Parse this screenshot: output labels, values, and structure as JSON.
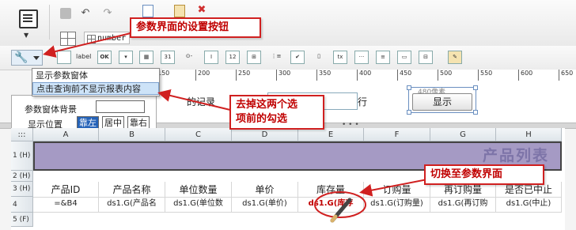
{
  "toolbar": {
    "number_control": "number"
  },
  "menu": {
    "items": [
      "显示参数窗体",
      "点击查询前不显示报表内容"
    ]
  },
  "settings_panel": {
    "bg_label": "参数窗体背景",
    "position_label": "显示位置",
    "position_options": [
      "靠左",
      "居中",
      "靠右"
    ],
    "selected_position": "靠左"
  },
  "ruler": {
    "ticks": [
      "150",
      "200",
      "250",
      "300",
      "350",
      "400",
      "450",
      "500",
      "550",
      "600",
      "650"
    ]
  },
  "param_canvas": {
    "record_text": "的记录",
    "row_text": "行",
    "size_tip": "480像素",
    "show_button": "显示"
  },
  "grid": {
    "columns": [
      "A",
      "B",
      "C",
      "D",
      "E",
      "F",
      "G",
      "H"
    ],
    "rows": [
      "1 (H)",
      "2 (H)",
      "3 (H)",
      "4",
      "5 (F)"
    ],
    "title": "产品列表",
    "headers": [
      "产品ID",
      "产品名称",
      "单位数量",
      "单价",
      "库存量",
      "订购量",
      "再订购量",
      "是否已中止"
    ],
    "data": [
      "=&B4",
      "ds1.G(产品名",
      "ds1.G(单位数",
      "ds1.G(单价)",
      "ds1.G(库存",
      "ds1.G(订购量)",
      "ds1.G(再订购",
      "ds1.G(中止)"
    ]
  },
  "annotations": {
    "settings": "参数界面的设置按钮",
    "uncheck": "去掉这两个选\n项前的勾选",
    "switch": "切换至参数界面"
  },
  "colors": {
    "callout": "#d02020",
    "title_band": "#a59ac4"
  }
}
